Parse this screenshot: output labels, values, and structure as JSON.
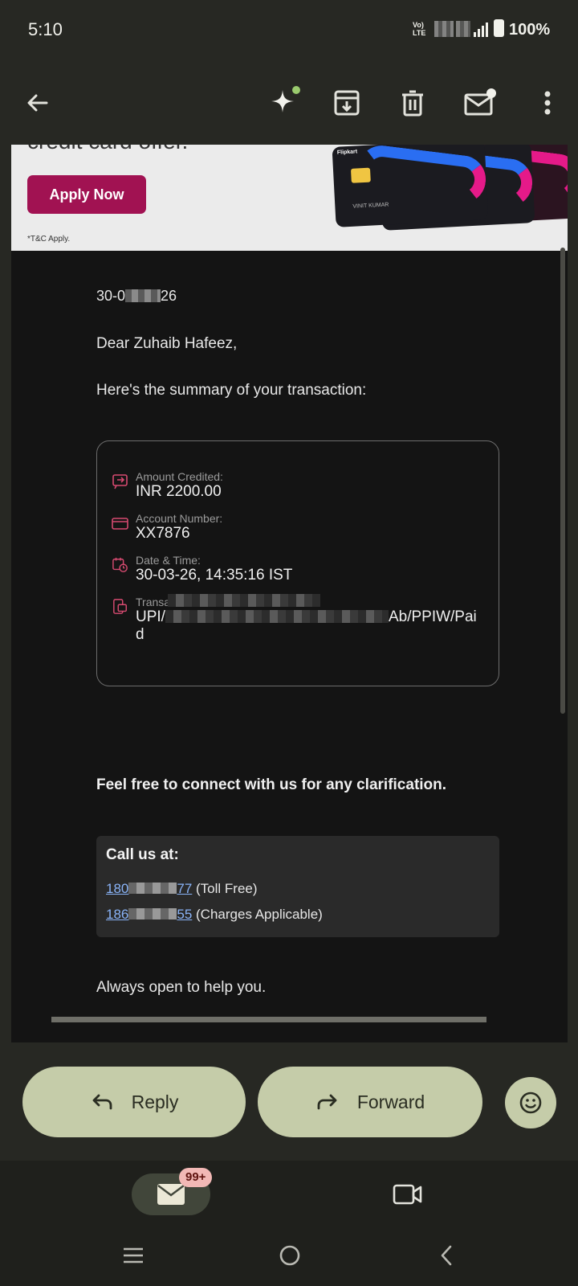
{
  "status_bar": {
    "time": "5:10",
    "network_line1": "Vo)",
    "network_line2": "LTE",
    "battery": "100%"
  },
  "app_bar": {
    "back_icon": "arrow-back-icon",
    "gemini_icon": "sparkle-icon",
    "archive_icon": "archive-icon",
    "delete_icon": "trash-icon",
    "mark_unread_icon": "mark-unread-icon",
    "more_icon": "more-vert-icon"
  },
  "email": {
    "promo": {
      "cut_text": "credit card offer.",
      "apply_label": "Apply Now",
      "tnc": "*T&C Apply.",
      "card_brand": "Flipkart",
      "card_name": "VINIT KUMAR"
    },
    "date_prefix": "30-0",
    "date_suffix": "26",
    "greeting": "Dear Zuhaib Hafeez,",
    "summary": "Here's the summary of your transaction:",
    "details": [
      {
        "label": "Amount Credited:",
        "value": "INR 2200.00",
        "icon": "receipt-icon"
      },
      {
        "label": "Account Number:",
        "value": "XX7876",
        "icon": "card-icon"
      },
      {
        "label": "Date & Time:",
        "value": "30-03-26, 14:35:16 IST",
        "icon": "calendar-clock-icon"
      },
      {
        "label": "Transa",
        "value_prefix": "UPI/",
        "value_suffix": "Ab/PPIW/Pai",
        "value_wrap": "d",
        "icon": "transaction-icon"
      }
    ],
    "feel_free": "Feel free to connect with us for any clarification.",
    "call_us": "Call us at:",
    "phones": [
      {
        "prefix": "180",
        "suffix": "77",
        "note": " (Toll Free)"
      },
      {
        "prefix": "186",
        "suffix": "55",
        "note": " (Charges Applicable)"
      }
    ],
    "closing": "Always open to help you."
  },
  "actions": {
    "reply": "Reply",
    "forward": "Forward",
    "emoji_icon": "emoji-smile-icon"
  },
  "bottom_nav": {
    "mail_badge": "99+",
    "mail_icon": "mail-icon",
    "meet_icon": "video-camera-icon"
  },
  "system_nav": {
    "recents_icon": "recents-icon",
    "home_icon": "home-circle-icon",
    "back_icon": "back-chevron-icon"
  },
  "colors": {
    "background": "#272823",
    "email_bg": "#141414",
    "button_pill": "#c5cca9",
    "apply_button": "#a11252",
    "link": "#8ab4f8",
    "accent_icon": "#d64a70"
  }
}
